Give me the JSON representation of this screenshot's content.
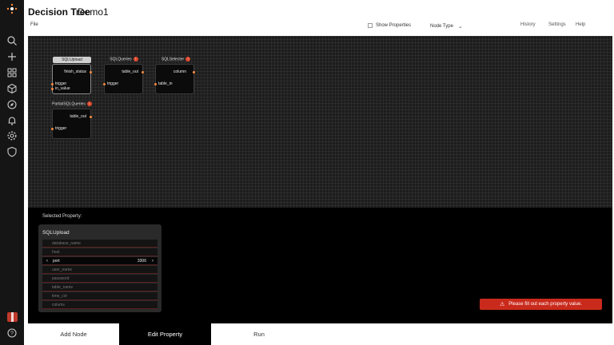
{
  "header": {
    "title": "Decision Tree",
    "subtitle": "Demo1"
  },
  "menu": {
    "file": "File"
  },
  "toolbar": {
    "show_properties": "Show Properties",
    "node_type": "Node Type"
  },
  "top_links": [
    "History",
    "Settings",
    "Help"
  ],
  "rail_icons": [
    "search-icon",
    "plus-icon",
    "grid-icon",
    "cube-icon",
    "compass-icon",
    "bell-icon",
    "gear-icon",
    "shield-icon",
    "gift-icon",
    "help-icon"
  ],
  "nodes": {
    "sqlupload": {
      "title": "SQLUpload",
      "out": "finish_status",
      "in1": "trigger",
      "in2": "in_value"
    },
    "sqlqueries": {
      "title": "SQLQueries",
      "badge": "!",
      "out": "table_out",
      "in1": "trigger"
    },
    "sqlselecter": {
      "title": "SQLSelecter",
      "badge": "!",
      "out": "column",
      "in1": "table_in"
    },
    "partialsql": {
      "title": "PartialSQLQueries",
      "badge": "!",
      "out": "table_out",
      "in1": "trigger"
    }
  },
  "selected_property": {
    "label": "Selected Property:",
    "node": "SQLUpload",
    "rows": [
      {
        "name": "database_name"
      },
      {
        "name": "host"
      },
      {
        "name": "port",
        "value": "3306"
      },
      {
        "name": "user_name"
      },
      {
        "name": "password"
      },
      {
        "name": "table_name"
      },
      {
        "name": "time_col"
      },
      {
        "name": "colums"
      }
    ]
  },
  "alert": {
    "message": "Please fill out each property value."
  },
  "tabs": [
    {
      "label": "Add Node"
    },
    {
      "label": "Edit Property"
    },
    {
      "label": "Run"
    }
  ],
  "colors": {
    "accent": "#c92a1c",
    "port_dot": "#ff8a3d",
    "canvas": "#1d1d1d"
  }
}
